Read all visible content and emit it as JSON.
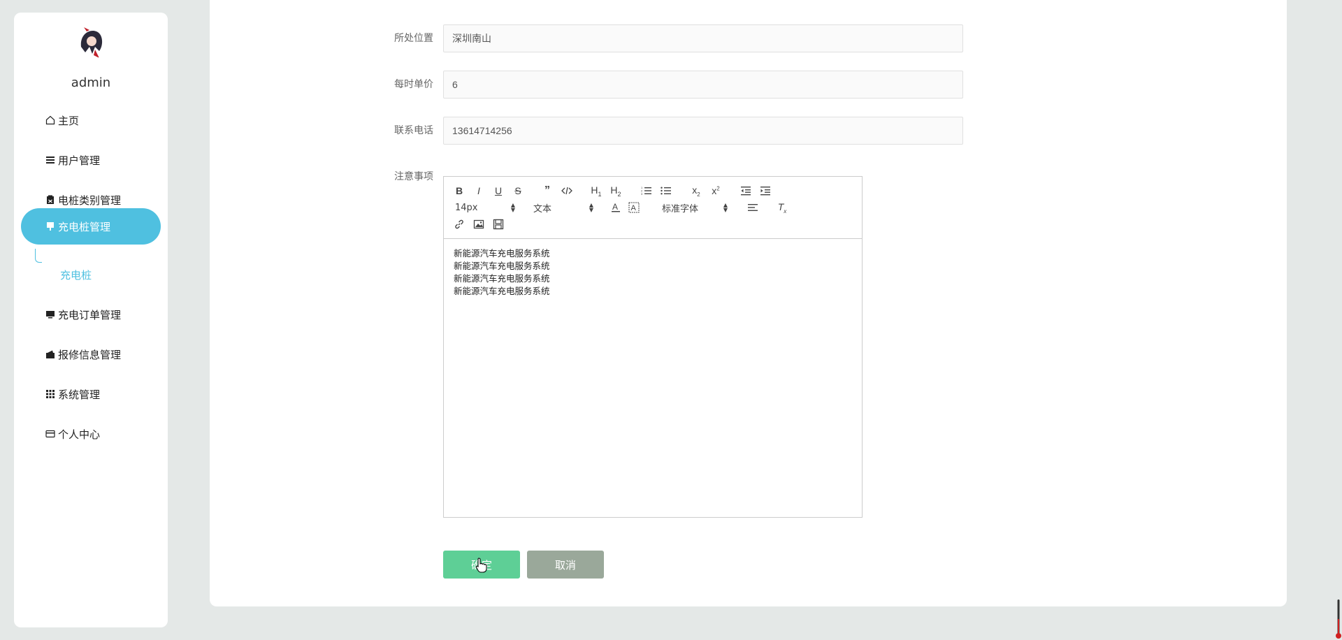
{
  "sidebar": {
    "username": "admin",
    "menu": [
      {
        "label": "主页",
        "icon": "home-icon"
      },
      {
        "label": "用户管理",
        "icon": "list-icon"
      },
      {
        "label": "电桩类别管理",
        "icon": "clipboard-icon"
      },
      {
        "label": "充电桩管理",
        "icon": "charger-icon"
      },
      {
        "label": "充电订单管理",
        "icon": "monitor-icon"
      },
      {
        "label": "报修信息管理",
        "icon": "wallet-icon"
      },
      {
        "label": "系统管理",
        "icon": "grid-icon"
      },
      {
        "label": "个人中心",
        "icon": "card-icon"
      }
    ],
    "submenu": {
      "label": "充电桩"
    },
    "accent_color": "#4fc0e0"
  },
  "form": {
    "location": {
      "label": "所处位置",
      "value": "深圳南山"
    },
    "price": {
      "label": "每时单价",
      "value": "6"
    },
    "phone": {
      "label": "联系电话",
      "value": "13614714256"
    },
    "notes": {
      "label": "注意事项"
    }
  },
  "editor": {
    "toolbar": {
      "size": "14px",
      "header": "文本",
      "font": "标准字体"
    },
    "content": [
      "新能源汽车充电服务系统",
      "新能源汽车充电服务系统",
      "新能源汽车充电服务系统",
      "新能源汽车充电服务系统"
    ]
  },
  "actions": {
    "confirm": "确定",
    "cancel": "取消",
    "confirm_color": "#5ecf96",
    "cancel_color": "#9aa89a"
  }
}
